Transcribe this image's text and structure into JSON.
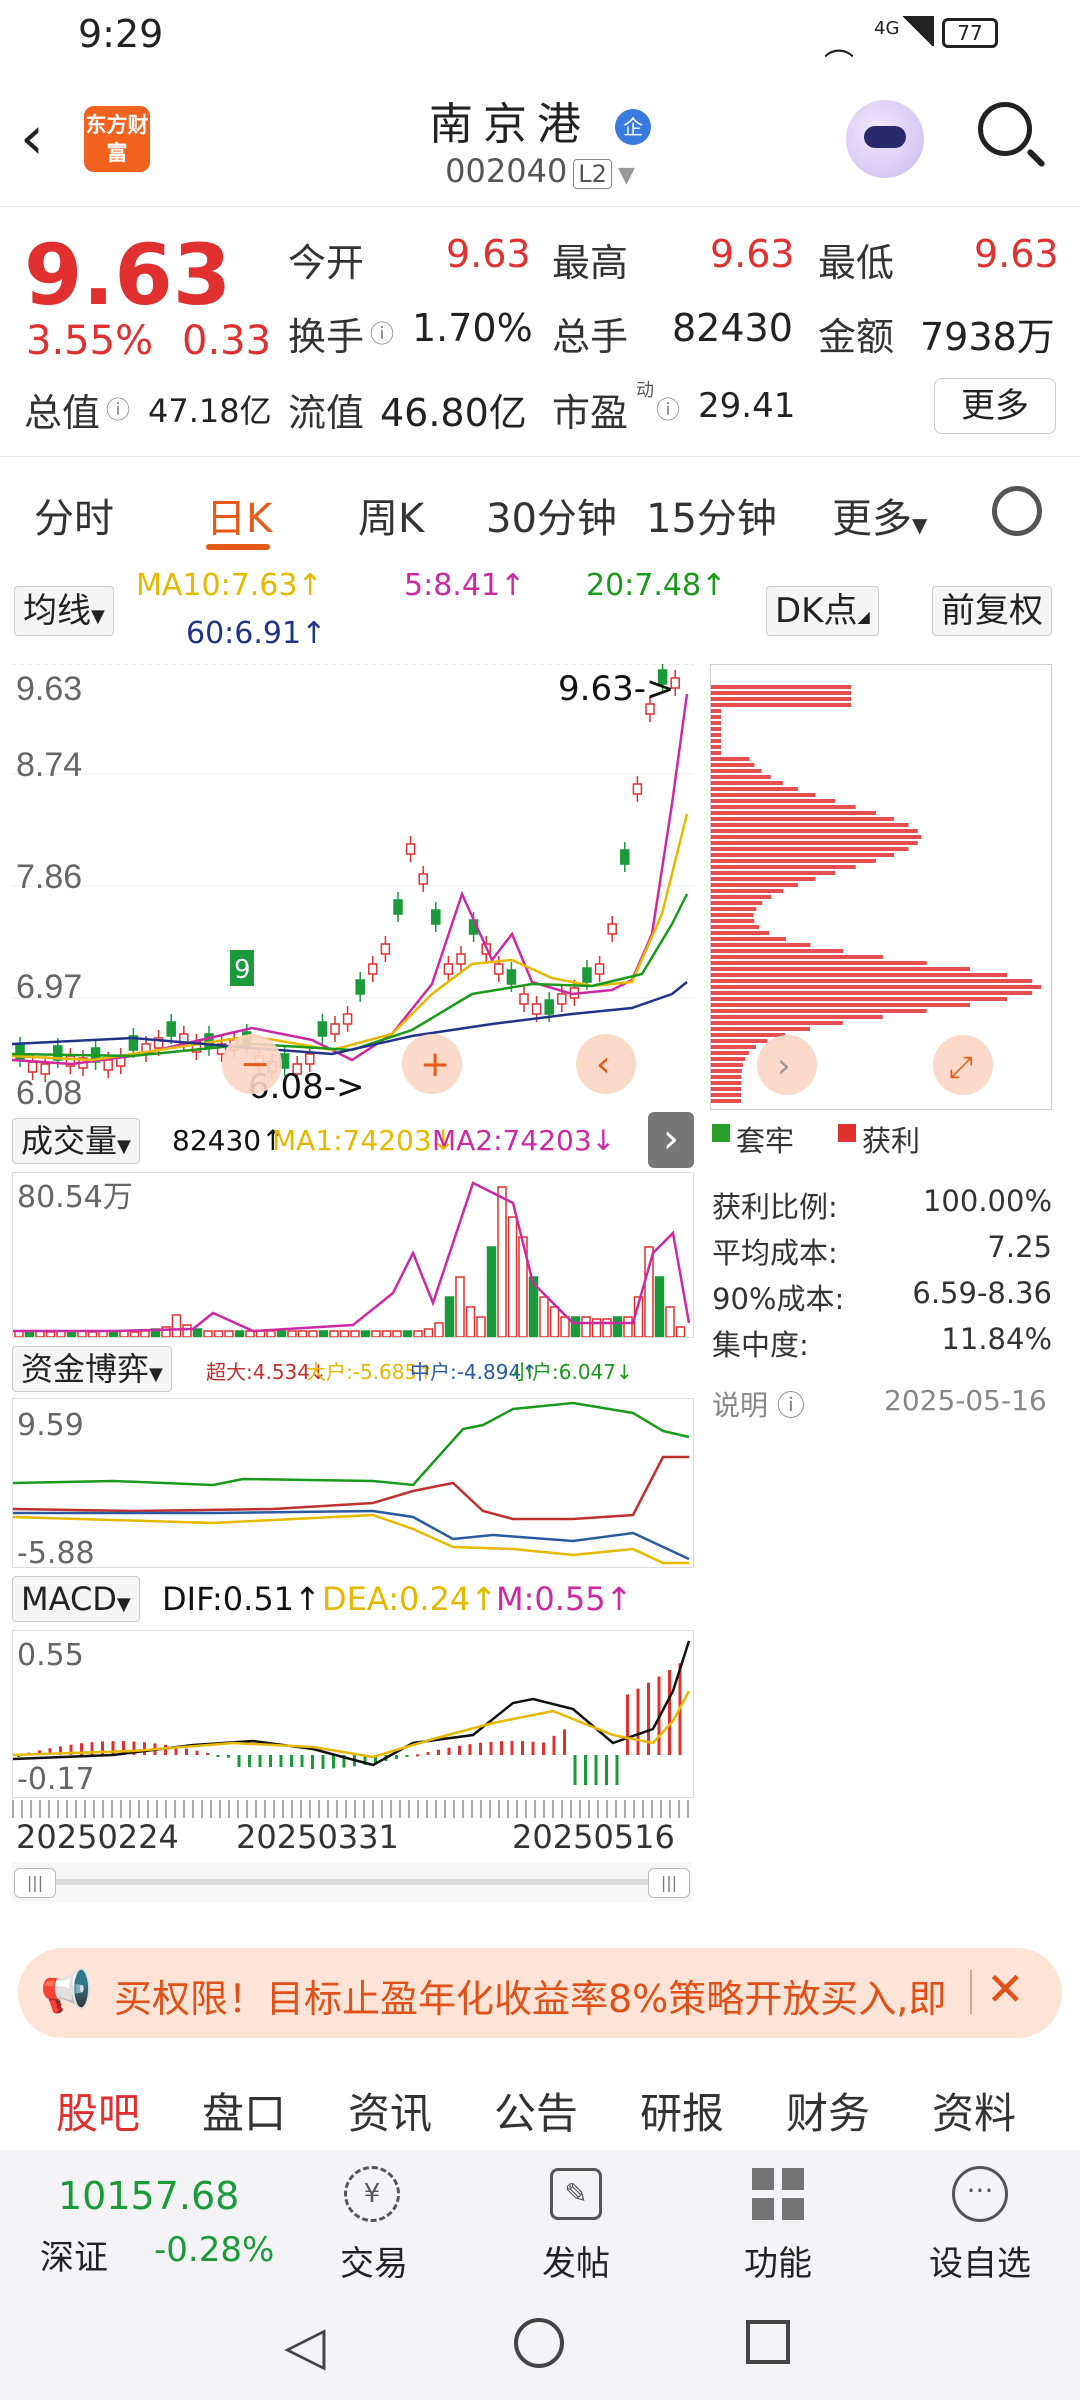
{
  "status": {
    "time": "9:29",
    "battery": "77",
    "signal_label": "4G"
  },
  "header": {
    "back_icon": "back-arrow-icon",
    "logo_text": "东方财富",
    "stock_name": "南京港",
    "stock_badge": "企",
    "stock_code": "002040",
    "level_badge": "L2"
  },
  "quote": {
    "price": "9.63",
    "pct_change": "3.55%",
    "change": "0.33",
    "open_label": "今开",
    "open": "9.63",
    "high_label": "最高",
    "high": "9.63",
    "low_label": "最低",
    "low": "9.63",
    "turnover_label": "换手",
    "turnover": "1.70%",
    "volume_label": "总手",
    "volume": "82430",
    "amount_label": "金额",
    "amount": "7938万",
    "total_value_label": "总值",
    "total_value": "47.18亿",
    "float_value_label": "流值",
    "float_value": "46.80亿",
    "pe_label": "市盈",
    "pe_sup": "动",
    "pe": "29.41",
    "more_label": "更多"
  },
  "tabs": {
    "items": [
      "分时",
      "日K",
      "周K",
      "30分钟",
      "15分钟",
      "更多"
    ],
    "active": "日K"
  },
  "ma_bar": {
    "select_label": "均线",
    "ma10": "MA10:7.63↑",
    "ma5": "5:8.41↑",
    "ma20": "20:7.48↑",
    "ma60": "60:6.91↑",
    "dk_label": "DK点",
    "adjust_label": "前复权"
  },
  "kchart": {
    "y_labels": [
      "9.63",
      "8.74",
      "7.86",
      "6.97",
      "6.08"
    ],
    "high_marker": "9.63->",
    "low_marker": "6.08->",
    "badge": "9",
    "minus": "−",
    "plus": "+"
  },
  "volume": {
    "select_label": "成交量",
    "value": "82430↑",
    "ma1": "MA1:74203↓",
    "ma2": "MA2:74203↓",
    "y_label": "80.54万"
  },
  "capital": {
    "select_label": "资金博弈",
    "super": "超大:4.534↓",
    "large": "大户:-5.685↑",
    "mid": "中户:-4.894↑",
    "small": "小户:6.047↓",
    "y_top": "9.59",
    "y_bot": "-5.88"
  },
  "macd": {
    "select_label": "MACD",
    "dif": "DIF:0.51↑",
    "dea": "DEA:0.24↑",
    "m": "M:0.55↑",
    "y_top": "0.55",
    "y_bot": "-0.17"
  },
  "dates": [
    "20250224",
    "20250331",
    "20250516"
  ],
  "cost_panel": {
    "legend_trapped": "套牢",
    "legend_profit": "获利",
    "rows": [
      {
        "label": "获利比例:",
        "value": "100.00%"
      },
      {
        "label": "平均成本:",
        "value": "7.25"
      },
      {
        "label": "90%成本:",
        "value": "6.59-8.36"
      },
      {
        "label": "集中度:",
        "value": "11.84%"
      }
    ],
    "note_label": "说明",
    "date": "2025-05-16"
  },
  "banner": {
    "text": "买权限！目标止盈年化收益率8%策略开放买入,即"
  },
  "bottom_tabs": {
    "items": [
      "股吧",
      "盘口",
      "资讯",
      "公告",
      "研报",
      "财务",
      "资料"
    ],
    "active": "股吧"
  },
  "dock": {
    "index_value": "10157.68",
    "index_name": "深证",
    "index_change": "-0.28%",
    "trade": "交易",
    "post": "发帖",
    "func": "功能",
    "watch": "设自选"
  },
  "colors": {
    "up": "#e03030",
    "down": "#1a9a3a",
    "accent": "#e65a1a"
  }
}
